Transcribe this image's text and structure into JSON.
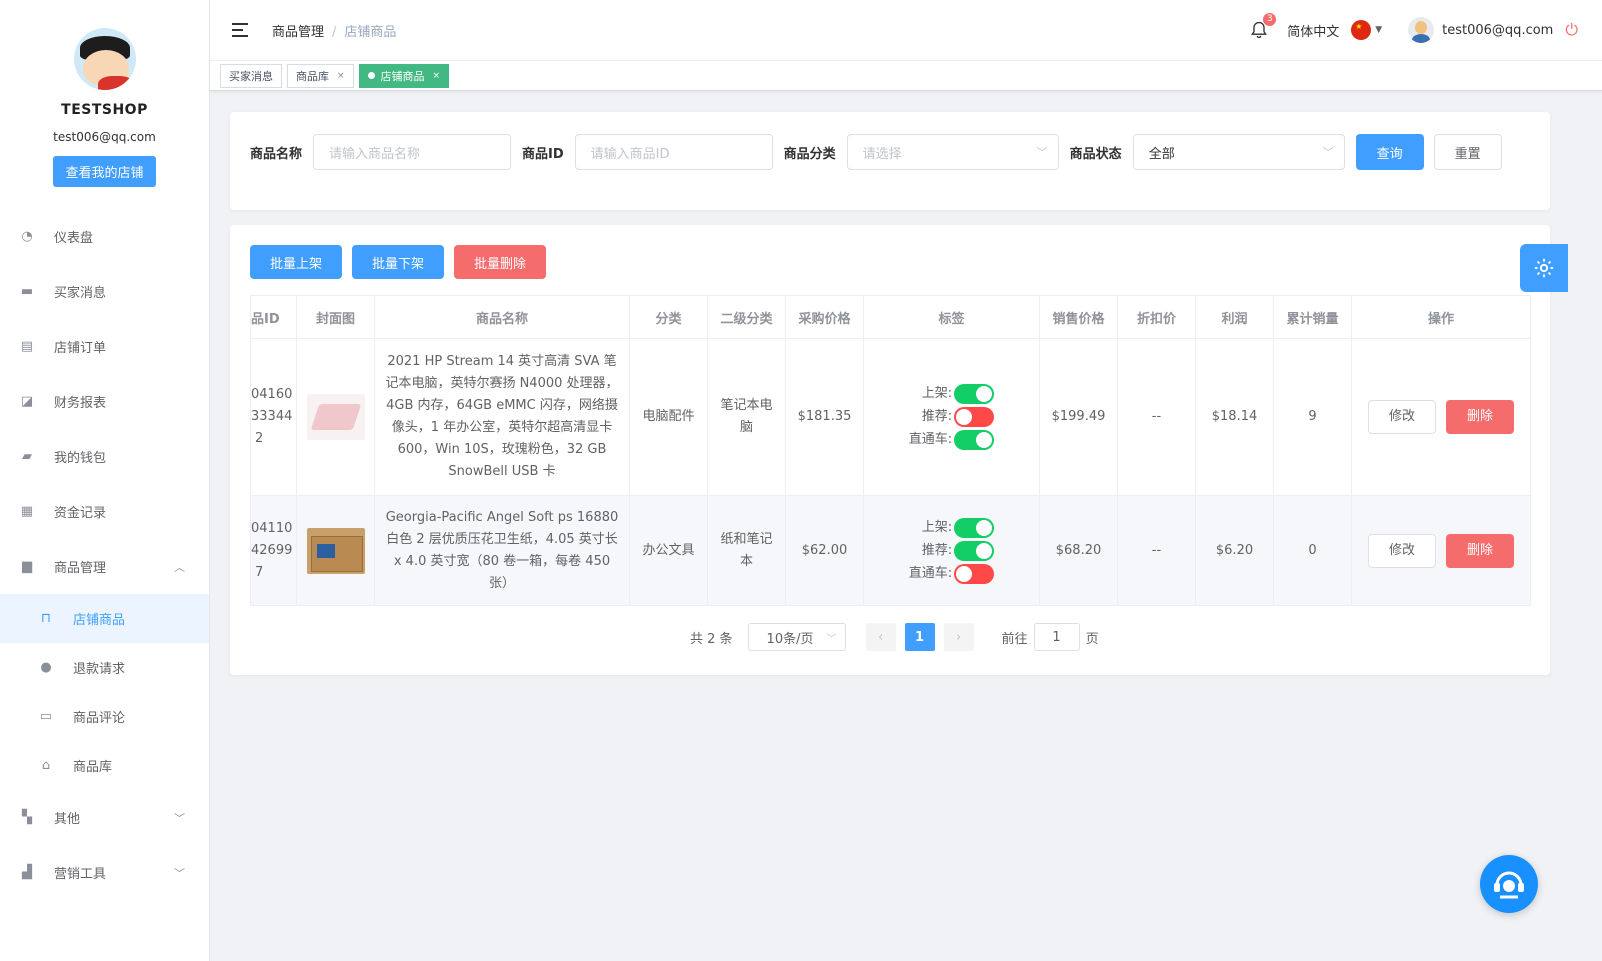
{
  "sidebar": {
    "shop_name": "TESTSHOP",
    "email": "test006@qq.com",
    "my_shop_button": "查看我的店铺",
    "menu": [
      {
        "label": "仪表盘",
        "icon": "dashboard-icon"
      },
      {
        "label": "买家消息",
        "icon": "message-icon"
      },
      {
        "label": "店铺订单",
        "icon": "clipboard-icon"
      },
      {
        "label": "财务报表",
        "icon": "chart-icon"
      },
      {
        "label": "我的钱包",
        "icon": "wallet-icon"
      },
      {
        "label": "资金记录",
        "icon": "document-icon"
      },
      {
        "label": "商品管理",
        "icon": "briefcase-icon"
      },
      {
        "label": "其他",
        "icon": "grid-icon"
      },
      {
        "label": "营销工具",
        "icon": "bar-chart-icon"
      }
    ],
    "submenu": [
      {
        "label": "店铺商品",
        "icon": "shopping-bag-icon"
      },
      {
        "label": "退款请求",
        "icon": "alert-icon"
      },
      {
        "label": "商品评论",
        "icon": "comment-icon"
      },
      {
        "label": "商品库",
        "icon": "home-icon"
      }
    ]
  },
  "header": {
    "breadcrumb_parent": "商品管理",
    "breadcrumb_separator": "/",
    "breadcrumb_current": "店铺商品",
    "notification_count": "3",
    "language": "简体中文",
    "user_email": "test006@qq.com"
  },
  "tags": [
    {
      "label": "买家消息"
    },
    {
      "label": "商品库",
      "close": "×"
    },
    {
      "label": "店铺商品",
      "close": "×"
    }
  ],
  "filter": {
    "name_label": "商品名称",
    "name_placeholder": "请输入商品名称",
    "id_label": "商品ID",
    "id_placeholder": "请输入商品ID",
    "category_label": "商品分类",
    "category_placeholder": "请选择",
    "status_label": "商品状态",
    "status_value": "全部",
    "search_button": "查询",
    "reset_button": "重置"
  },
  "bulk": {
    "list_button": "批量上架",
    "unlist_button": "批量下架",
    "delete_button": "批量删除"
  },
  "table": {
    "headers": [
      "品ID",
      "封面图",
      "商品名称",
      "分类",
      "二级分类",
      "采购价格",
      "标签",
      "销售价格",
      "折扣价",
      "利润",
      "累计销量",
      "操作"
    ],
    "tag_labels": [
      "上架:",
      "推荐:",
      "直通车:"
    ],
    "edit_label": "修改",
    "delete_label": "删除",
    "rows": [
      {
        "id_lines": [
          "04160",
          "33344",
          "2"
        ],
        "name": "2021 HP Stream 14 英寸高清 SVA 笔记本电脑，英特尔赛扬 N4000 处理器，4GB 内存，64GB eMMC 闪存，网络摄像头，1 年办公室，英特尔超高清显卡 600，Win 10S，玫瑰粉色，32 GB SnowBell USB 卡",
        "category": "电脑配件",
        "subcategory": "笔记本电脑",
        "purchase_price": "$181.35",
        "tags": {
          "listed": true,
          "recommended": false,
          "express": true
        },
        "sale_price": "$199.49",
        "discount": "--",
        "profit": "$18.14",
        "sales": "9"
      },
      {
        "id_lines": [
          "04110",
          "42699",
          "7"
        ],
        "name": "Georgia-Pacific Angel Soft ps 16880 白色 2 层优质压花卫生纸，4.05 英寸长 x 4.0 英寸宽（80 卷一箱，每卷 450 张）",
        "category": "办公文具",
        "subcategory": "纸和笔记本",
        "purchase_price": "$62.00",
        "tags": {
          "listed": true,
          "recommended": true,
          "express": false
        },
        "sale_price": "$68.20",
        "discount": "--",
        "profit": "$6.20",
        "sales": "0"
      }
    ]
  },
  "pagination": {
    "total": "共 2 条",
    "page_size": "10条/页",
    "current_page": "1",
    "goto_label": "前往",
    "goto_value": "1",
    "page_suffix": "页"
  }
}
